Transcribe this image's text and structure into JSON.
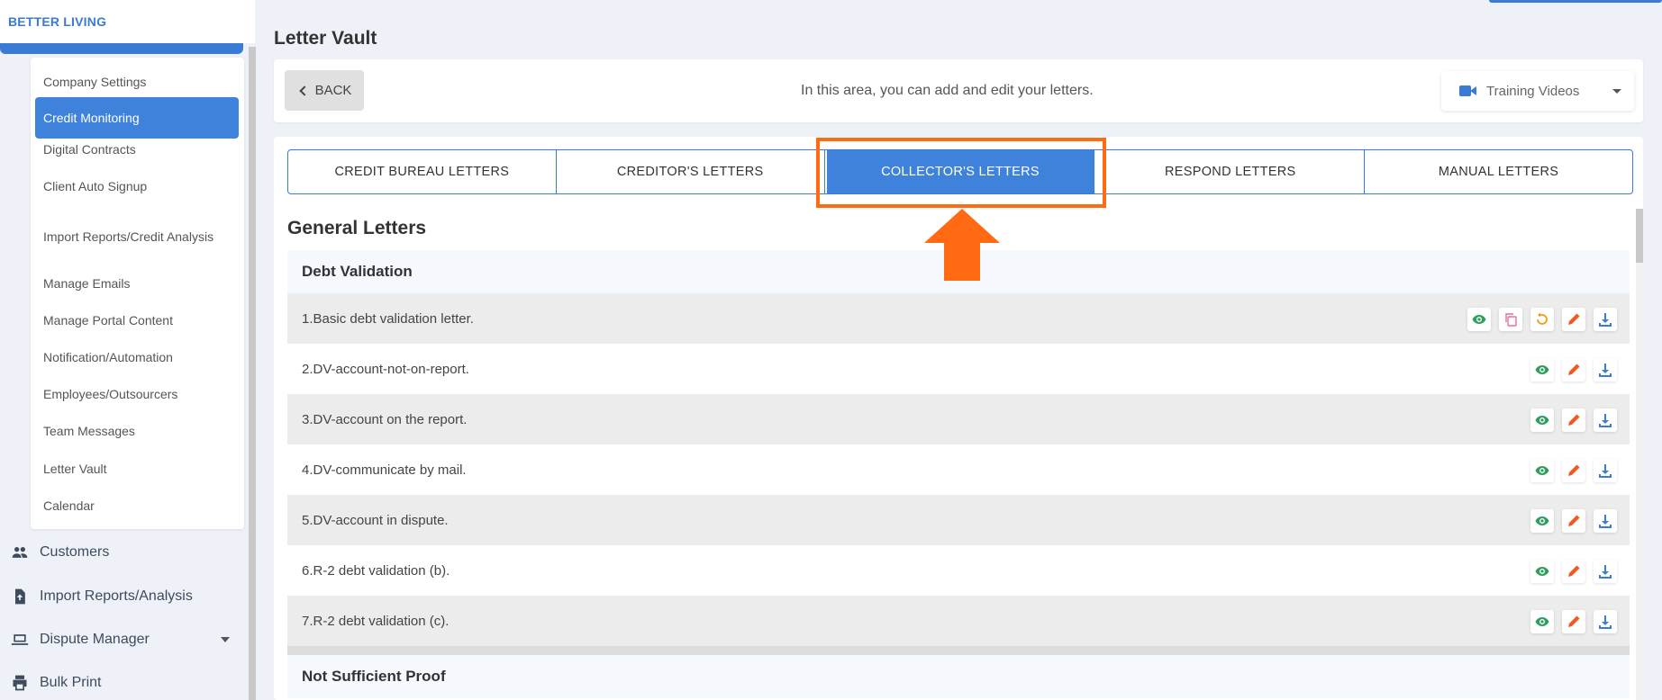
{
  "brand": {
    "name": "BETTER LIVING"
  },
  "sidebar": {
    "submenu": [
      {
        "label": "Company Settings",
        "name": "sidebar-item-company-settings"
      },
      {
        "label": "Credit Monitoring",
        "name": "sidebar-item-credit-monitoring",
        "active": true
      },
      {
        "label": "Digital Contracts",
        "name": "sidebar-item-digital-contracts"
      },
      {
        "label": "Client Auto Signup",
        "name": "sidebar-item-client-auto-signup"
      },
      {
        "label": "Import Reports/Credit Analysis",
        "name": "sidebar-item-import-reports-credit-analysis"
      },
      {
        "label": "Manage Emails",
        "name": "sidebar-item-manage-emails"
      },
      {
        "label": "Manage Portal Content",
        "name": "sidebar-item-manage-portal-content"
      },
      {
        "label": "Notification/Automation",
        "name": "sidebar-item-notification-automation"
      },
      {
        "label": "Employees/Outsourcers",
        "name": "sidebar-item-employees-outsourcers"
      },
      {
        "label": "Team Messages",
        "name": "sidebar-item-team-messages"
      },
      {
        "label": "Letter Vault",
        "name": "sidebar-item-letter-vault"
      },
      {
        "label": "Calendar",
        "name": "sidebar-item-calendar"
      }
    ],
    "main": [
      {
        "label": "Customers",
        "icon": "users-icon"
      },
      {
        "label": "Import Reports/Analysis",
        "icon": "file-upload-icon"
      },
      {
        "label": "Dispute Manager",
        "icon": "laptop-icon"
      },
      {
        "label": "Bulk Print",
        "icon": "printer-icon"
      }
    ]
  },
  "page": {
    "title": "Letter Vault",
    "back_label": "BACK",
    "header_message": "In this area, you can add and edit your letters.",
    "training_label": "Training Videos"
  },
  "tabs": [
    {
      "label": "CREDIT BUREAU LETTERS",
      "active": false
    },
    {
      "label": "CREDITOR'S LETTERS",
      "active": false
    },
    {
      "label": "COLLECTOR'S LETTERS",
      "active": true
    },
    {
      "label": "RESPOND LETTERS",
      "active": false
    },
    {
      "label": "MANUAL LETTERS",
      "active": false
    }
  ],
  "content": {
    "section_title": "General Letters",
    "groups": [
      {
        "title": "Debt Validation",
        "letters": [
          {
            "label": "1.Basic debt validation letter.",
            "actions": [
              "view",
              "copy",
              "reset",
              "edit",
              "download"
            ]
          },
          {
            "label": "2.DV-account-not-on-report.",
            "actions": [
              "view",
              "edit",
              "download"
            ]
          },
          {
            "label": "3.DV-account on the report.",
            "actions": [
              "view",
              "edit",
              "download"
            ]
          },
          {
            "label": "4.DV-communicate by mail.",
            "actions": [
              "view",
              "edit",
              "download"
            ]
          },
          {
            "label": "5.DV-account in dispute.",
            "actions": [
              "view",
              "edit",
              "download"
            ]
          },
          {
            "label": "6.R-2 debt validation (b).",
            "actions": [
              "view",
              "edit",
              "download"
            ]
          },
          {
            "label": "7.R-2 debt validation (c).",
            "actions": [
              "view",
              "edit",
              "download"
            ]
          }
        ]
      },
      {
        "title": "Not Sufficient Proof",
        "letters": []
      }
    ]
  },
  "colors": {
    "accent": "#3f82dc",
    "annotation": "#ff6a13",
    "view": "#2e9e5b",
    "copy": "#e86f9c",
    "reset": "#f39c12",
    "edit": "#ee5a24",
    "download": "#3a7bd5"
  }
}
